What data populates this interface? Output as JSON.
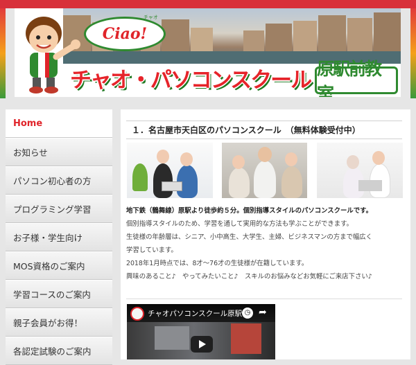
{
  "banner": {
    "ciao": "Ciao!",
    "ciao_ruby": "チャオ",
    "school_name": "チャオ・パソコンスクール",
    "branch": "原駅前教室"
  },
  "nav": {
    "items": [
      {
        "label": "Home",
        "active": true
      },
      {
        "label": "お知らせ"
      },
      {
        "label": "パソコン初心者の方"
      },
      {
        "label": "プログラミング学習"
      },
      {
        "label": "お子様・学生向け"
      },
      {
        "label": "MOS資格のご案内"
      },
      {
        "label": "学習コースのご案内"
      },
      {
        "label": "親子会員がお得！"
      },
      {
        "label": "各認定試験のご案内"
      }
    ]
  },
  "main": {
    "heading": "１．名古屋市天白区のパソコンスクール　（無料体験受付中）",
    "lead": "地下鉄（鶴舞線）原駅より徒歩約５分。個別指導スタイルのパソコンスクールです。",
    "lines": [
      "個別指導スタイルのため、学習を通して実用的な方法も学ぶことができます。",
      "生徒様の年齢層は、シニア、小中高生、大学生、主婦、ビジネスマンの方まで幅広く",
      "学習しています。",
      "2018年1月時点では、8才～76才の生徒様が在籍しています。",
      "興味のあること♪　やってみたいこと♪　スキルのお悩みなどお気軽にご来店下さい♪"
    ],
    "video": {
      "title": "チャオパソコンスクール原駅..."
    }
  },
  "colors": {
    "accent_red": "#e0242a",
    "accent_green": "#2f8a30"
  }
}
